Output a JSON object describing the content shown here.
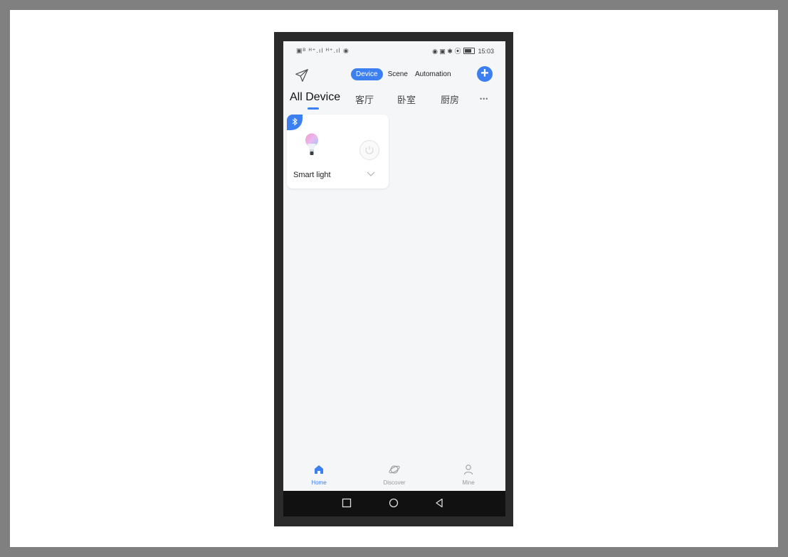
{
  "status_bar": {
    "left_indicators": "▣ᴮ ᴴ⁺.ıl ᴴ⁺.ıl ◉",
    "right_indicators": "◉ ▣ ✱ ⦿",
    "time": "15:03"
  },
  "header": {
    "segments": [
      {
        "label": "Device",
        "selected": true
      },
      {
        "label": "Scene",
        "selected": false
      },
      {
        "label": "Automation",
        "selected": false
      }
    ],
    "add_button_label": "+"
  },
  "rooms": {
    "tabs": [
      "All Device",
      "客厅",
      "卧室",
      "厨房"
    ],
    "active_index": 0,
    "more_label": "•••"
  },
  "devices": [
    {
      "name": "Smart light",
      "connection": "bluetooth-icon",
      "power_on": false
    }
  ],
  "bottom_nav": [
    {
      "label": "Home",
      "icon": "home-icon",
      "active": true
    },
    {
      "label": "Discover",
      "icon": "planet-icon",
      "active": false
    },
    {
      "label": "Mine",
      "icon": "user-icon",
      "active": false
    }
  ],
  "colors": {
    "accent": "#3c7ff0",
    "background": "#f5f6f8"
  }
}
